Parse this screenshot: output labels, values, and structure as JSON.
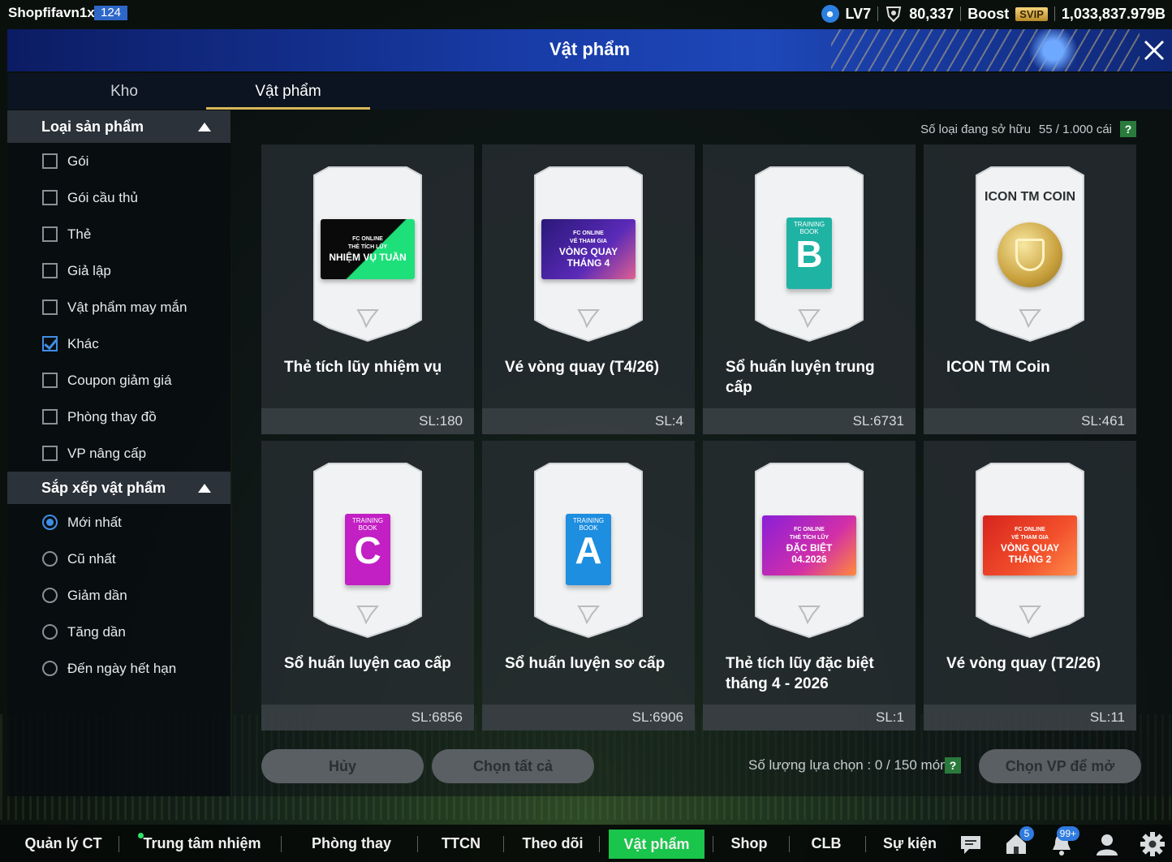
{
  "top": {
    "username": "Shopfifavn1x",
    "user_badge": "124",
    "level": "LV7",
    "currency": "80,337",
    "boost_label": "Boost",
    "svip": "SVIP",
    "balance": "1,033,837.979B"
  },
  "window": {
    "title": "Vật phẩm"
  },
  "tabs": [
    {
      "label": "Kho",
      "active": false
    },
    {
      "label": "Vật phẩm",
      "active": true
    }
  ],
  "filters": {
    "type_header": "Loại sản phẩm",
    "type_options": [
      {
        "label": "Gói",
        "checked": false
      },
      {
        "label": "Gói cầu thủ",
        "checked": false
      },
      {
        "label": "Thẻ",
        "checked": false
      },
      {
        "label": "Giả lập",
        "checked": false
      },
      {
        "label": "Vật phẩm may mắn",
        "checked": false
      },
      {
        "label": "Khác",
        "checked": true
      },
      {
        "label": "Coupon giảm giá",
        "checked": false
      },
      {
        "label": "Phòng thay đồ",
        "checked": false
      },
      {
        "label": "VP nâng cấp",
        "checked": false
      }
    ],
    "sort_header": "Sắp xếp vật phẩm",
    "sort_options": [
      {
        "label": "Mới nhất",
        "selected": true
      },
      {
        "label": "Cũ nhất",
        "selected": false
      },
      {
        "label": "Giảm dần",
        "selected": false
      },
      {
        "label": "Tăng dần",
        "selected": false
      },
      {
        "label": "Đến ngày hết hạn",
        "selected": false
      }
    ]
  },
  "owned": {
    "label": "Số loại đang sở hữu",
    "value": "55 / 1.000 cái",
    "help": "?"
  },
  "items": [
    {
      "name": "Thẻ tích lũy nhiệm vụ",
      "qty": "SL:180",
      "art": "mission",
      "art_lines": [
        "FC ONLINE",
        "THẺ TÍCH LŨY",
        "NHIỆM VỤ TUẦN"
      ]
    },
    {
      "name": "Vé vòng quay (T4/26)",
      "qty": "SL:4",
      "art": "ticket-purple",
      "art_lines": [
        "FC ONLINE",
        "VÉ THAM GIA",
        "VÒNG QUAY",
        "THÁNG 4"
      ]
    },
    {
      "name": "Sổ huấn luyện trung cấp",
      "qty": "SL:6731",
      "art": "book",
      "art_lines": [
        "TRAINING BOOK",
        "B"
      ],
      "color": "#1fb3a4"
    },
    {
      "name": "ICON TM Coin",
      "qty": "SL:461",
      "art": "coin",
      "art_lines": [
        "ICON TM COIN"
      ]
    },
    {
      "name": "Sổ huấn luyện cao cấp",
      "qty": "SL:6856",
      "art": "book",
      "art_lines": [
        "TRAINING BOOK",
        "C"
      ],
      "color": "#c21fc4"
    },
    {
      "name": "Sổ huấn luyện sơ cấp",
      "qty": "SL:6906",
      "art": "book",
      "art_lines": [
        "TRAINING BOOK",
        "A"
      ],
      "color": "#1d8ee0"
    },
    {
      "name": "Thẻ tích lũy đặc biệt tháng 4 - 2026",
      "qty": "SL:1",
      "art": "special",
      "art_lines": [
        "FC ONLINE",
        "THẺ TÍCH LŨY",
        "ĐẶC BIỆT",
        "04.2026"
      ]
    },
    {
      "name": "Vé vòng quay (T2/26)",
      "qty": "SL:11",
      "art": "ticket-red",
      "art_lines": [
        "FC ONLINE",
        "VÉ THAM GIA",
        "VÒNG QUAY",
        "THÁNG 2"
      ]
    }
  ],
  "actions": {
    "cancel": "Hủy",
    "select_all": "Chọn tất cả",
    "selection_label": "Số lượng lựa chọn : 0 / 150 món",
    "open": "Chọn VP để mở"
  },
  "nav": {
    "items": [
      "Quản lý CT",
      "Trung tâm nhiệm vụ",
      "Phòng thay đồ",
      "TTCN",
      "Theo dõi",
      "Vật phẩm",
      "Shop",
      "CLB",
      "Sự kiện"
    ],
    "active": "Vật phẩm",
    "home_badge": "5",
    "notif_badge": "99+"
  }
}
